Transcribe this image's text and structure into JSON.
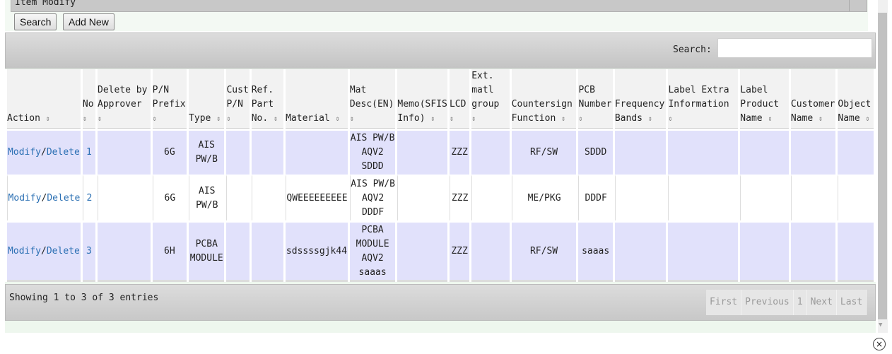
{
  "window": {
    "title": "Item Modify"
  },
  "top_buttons": {
    "search": "Search",
    "add_new": "Add New"
  },
  "toolbar": {
    "search_label": "Search:",
    "search_value": ""
  },
  "table": {
    "columns": [
      "Action",
      "No",
      "Delete by Approver",
      "P/N Prefix",
      "Type",
      "Cust P/N",
      "Ref. Part No.",
      "Material",
      "Mat Desc(EN)",
      "Memo(SFIS Info)",
      "LCD",
      "Ext. matl group",
      "Countersign Function",
      "PCB Number",
      "Frequency Bands",
      "Label Extra Information",
      "Label Product Name",
      "Customer Name",
      "Object Name"
    ],
    "sort_icon": "⇕",
    "rows": [
      {
        "modify": "Modify",
        "sep": "/",
        "delete": "Delete",
        "no": "1",
        "delete_by_approver": "",
        "pn_prefix": "6G",
        "type": "AIS PW/B",
        "cust_pn": "",
        "ref_part_no": "",
        "material": "",
        "mat_desc_en": "AIS PW/B AQV2 SDDD",
        "memo": "",
        "lcd": "ZZZ",
        "ext_matl_group": "",
        "countersign_function": "RF/SW",
        "pcb_number": "SDDD",
        "frequency_bands": "",
        "label_extra_info": "",
        "label_product_name": "",
        "customer_name": "",
        "object_name": ""
      },
      {
        "modify": "Modify",
        "sep": "/",
        "delete": "Delete",
        "no": "2",
        "delete_by_approver": "",
        "pn_prefix": "6G",
        "type": "AIS PW/B",
        "cust_pn": "",
        "ref_part_no": "",
        "material": "QWEEEEEEEEE",
        "mat_desc_en": "AIS PW/B AQV2 DDDF",
        "memo": "",
        "lcd": "ZZZ",
        "ext_matl_group": "",
        "countersign_function": "ME/PKG",
        "pcb_number": "DDDF",
        "frequency_bands": "",
        "label_extra_info": "",
        "label_product_name": "",
        "customer_name": "",
        "object_name": ""
      },
      {
        "modify": "Modify",
        "sep": "/",
        "delete": "Delete",
        "no": "3",
        "delete_by_approver": "",
        "pn_prefix": "6H",
        "type": "PCBA MODULE",
        "cust_pn": "",
        "ref_part_no": "",
        "material": "sdssssgjk44",
        "mat_desc_en": "PCBA MODULE AQV2 saaas",
        "memo": "",
        "lcd": "ZZZ",
        "ext_matl_group": "",
        "countersign_function": "RF/SW",
        "pcb_number": "saaas",
        "frequency_bands": "",
        "label_extra_info": "",
        "label_product_name": "",
        "customer_name": "",
        "object_name": ""
      }
    ]
  },
  "footer": {
    "info": "Showing 1 to 3 of 3 entries",
    "pager": {
      "first": "First",
      "previous": "Previous",
      "page": "1",
      "next": "Next",
      "last": "Last"
    }
  },
  "icons": {
    "close": "×",
    "scroll_down": "▼"
  }
}
